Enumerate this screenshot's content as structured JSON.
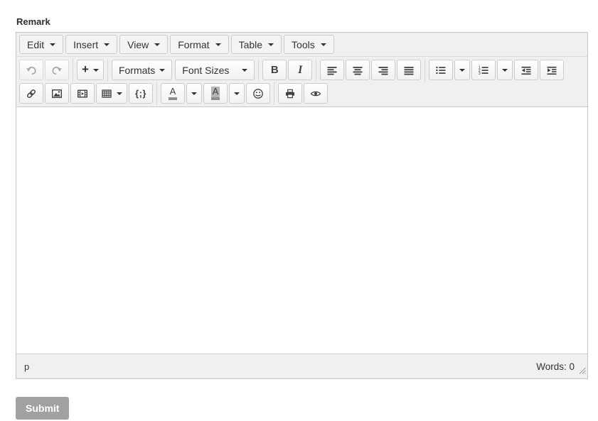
{
  "page": {
    "field_label": "Remark"
  },
  "colors": {
    "toolbar_bg": "#f0f0f0",
    "container_border": "#c5c5c5",
    "button_border": "#cccccc",
    "icon": "#404040",
    "icon_disabled": "#a6a6a6",
    "forecolor_bar": "#8f8f8f",
    "backcolor_swatch": "#b5b5b5",
    "submit_bg": "#a1a1a1",
    "submit_text": "#ffffff"
  },
  "menubar": {
    "items": [
      {
        "label": "Edit"
      },
      {
        "label": "Insert"
      },
      {
        "label": "View"
      },
      {
        "label": "Format"
      },
      {
        "label": "Table"
      },
      {
        "label": "Tools"
      }
    ]
  },
  "toolbar": {
    "plus_label": "+",
    "formats_label": "Formats",
    "font_sizes_label": "Font Sizes",
    "bold_label": "B",
    "italic_label": "I",
    "codesample_label": "{;}",
    "forecolor_letter": "A",
    "backcolor_letter": "A",
    "icons": {
      "undo": "curved-arrow-left",
      "redo": "curved-arrow-right",
      "align-left": "lines-left",
      "align-center": "lines-center",
      "align-right": "lines-right",
      "justify": "lines-full",
      "bullet-list": "dots-and-lines",
      "numbered-list": "digits-and-lines",
      "outdent": "left-arrow-lines",
      "indent": "right-arrow-lines",
      "link": "chain",
      "image": "picture-frame",
      "media": "filmstrip-play",
      "table": "grid",
      "emoticon": "smiley-face",
      "print": "printer",
      "preview": "eye",
      "dropdown-caret": "▼",
      "resize-handle": "diagonal-grip"
    }
  },
  "statusbar": {
    "element_path": "p",
    "word_count": "Words: 0"
  },
  "actions": {
    "submit_label": "Submit"
  }
}
